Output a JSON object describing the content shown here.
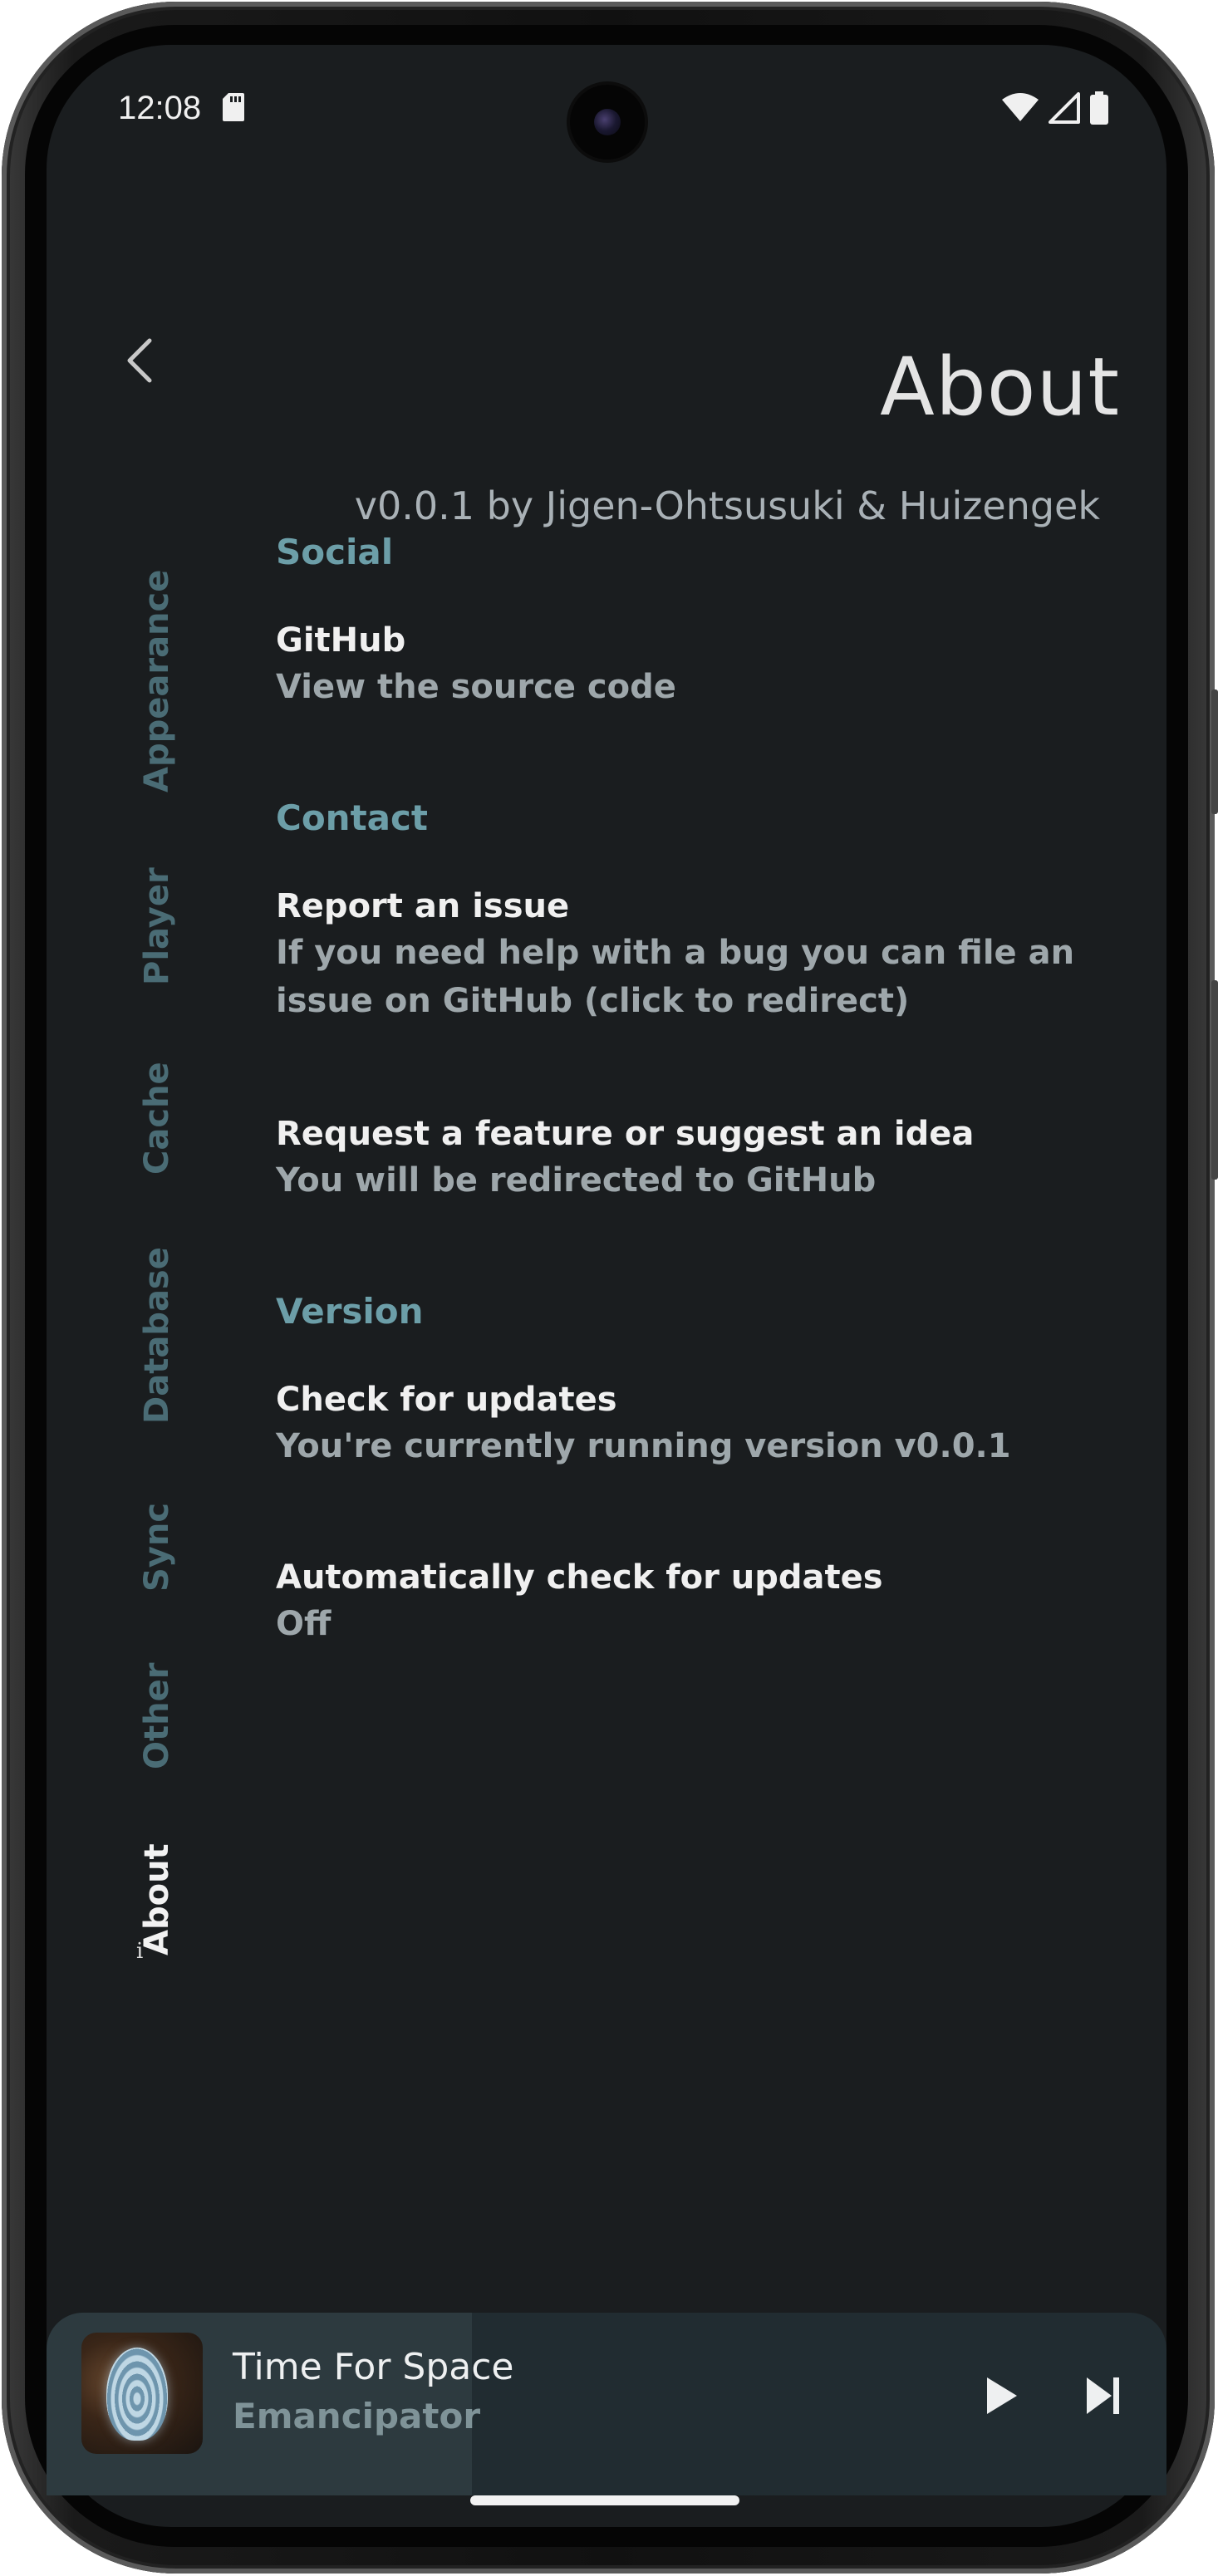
{
  "status_bar": {
    "time": "12:08",
    "icons": [
      "sd-card-icon",
      "wifi-icon",
      "cell-signal-icon",
      "battery-icon"
    ]
  },
  "header": {
    "back_icon": "chevron-left-icon",
    "title": "About",
    "version_line": "v0.0.1 by Jigen-Ohtsusuki & Huizengek"
  },
  "sidebar": {
    "active_icon": "info-icon",
    "items": [
      {
        "label": "Appearance",
        "active": false
      },
      {
        "label": "Player",
        "active": false
      },
      {
        "label": "Cache",
        "active": false
      },
      {
        "label": "Database",
        "active": false
      },
      {
        "label": "Sync",
        "active": false
      },
      {
        "label": "Other",
        "active": false
      },
      {
        "label": "About",
        "active": true
      }
    ]
  },
  "sections": [
    {
      "header": "Social",
      "items": [
        {
          "title": "GitHub",
          "subtitle": "View the source code"
        }
      ]
    },
    {
      "header": "Contact",
      "items": [
        {
          "title": "Report an issue",
          "subtitle": "If you need help with a bug you can file an issue on GitHub (click to redirect)"
        },
        {
          "title": "Request a feature or suggest an idea",
          "subtitle": "You will be redirected to GitHub"
        }
      ]
    },
    {
      "header": "Version",
      "items": [
        {
          "title": "Check for updates",
          "subtitle": "You're currently running version v0.0.1"
        },
        {
          "title": "Automatically check for updates",
          "subtitle": "Off"
        }
      ]
    }
  ],
  "mini_player": {
    "title": "Time For Space",
    "artist": "Emancipator",
    "progress": 0.38,
    "controls": [
      "play-icon",
      "skip-next-icon"
    ]
  },
  "colors": {
    "background": "#1a1d1f",
    "accent": "#6c9ea8",
    "inactive_tab": "#4a6c75",
    "player_bg": "#212c31"
  }
}
